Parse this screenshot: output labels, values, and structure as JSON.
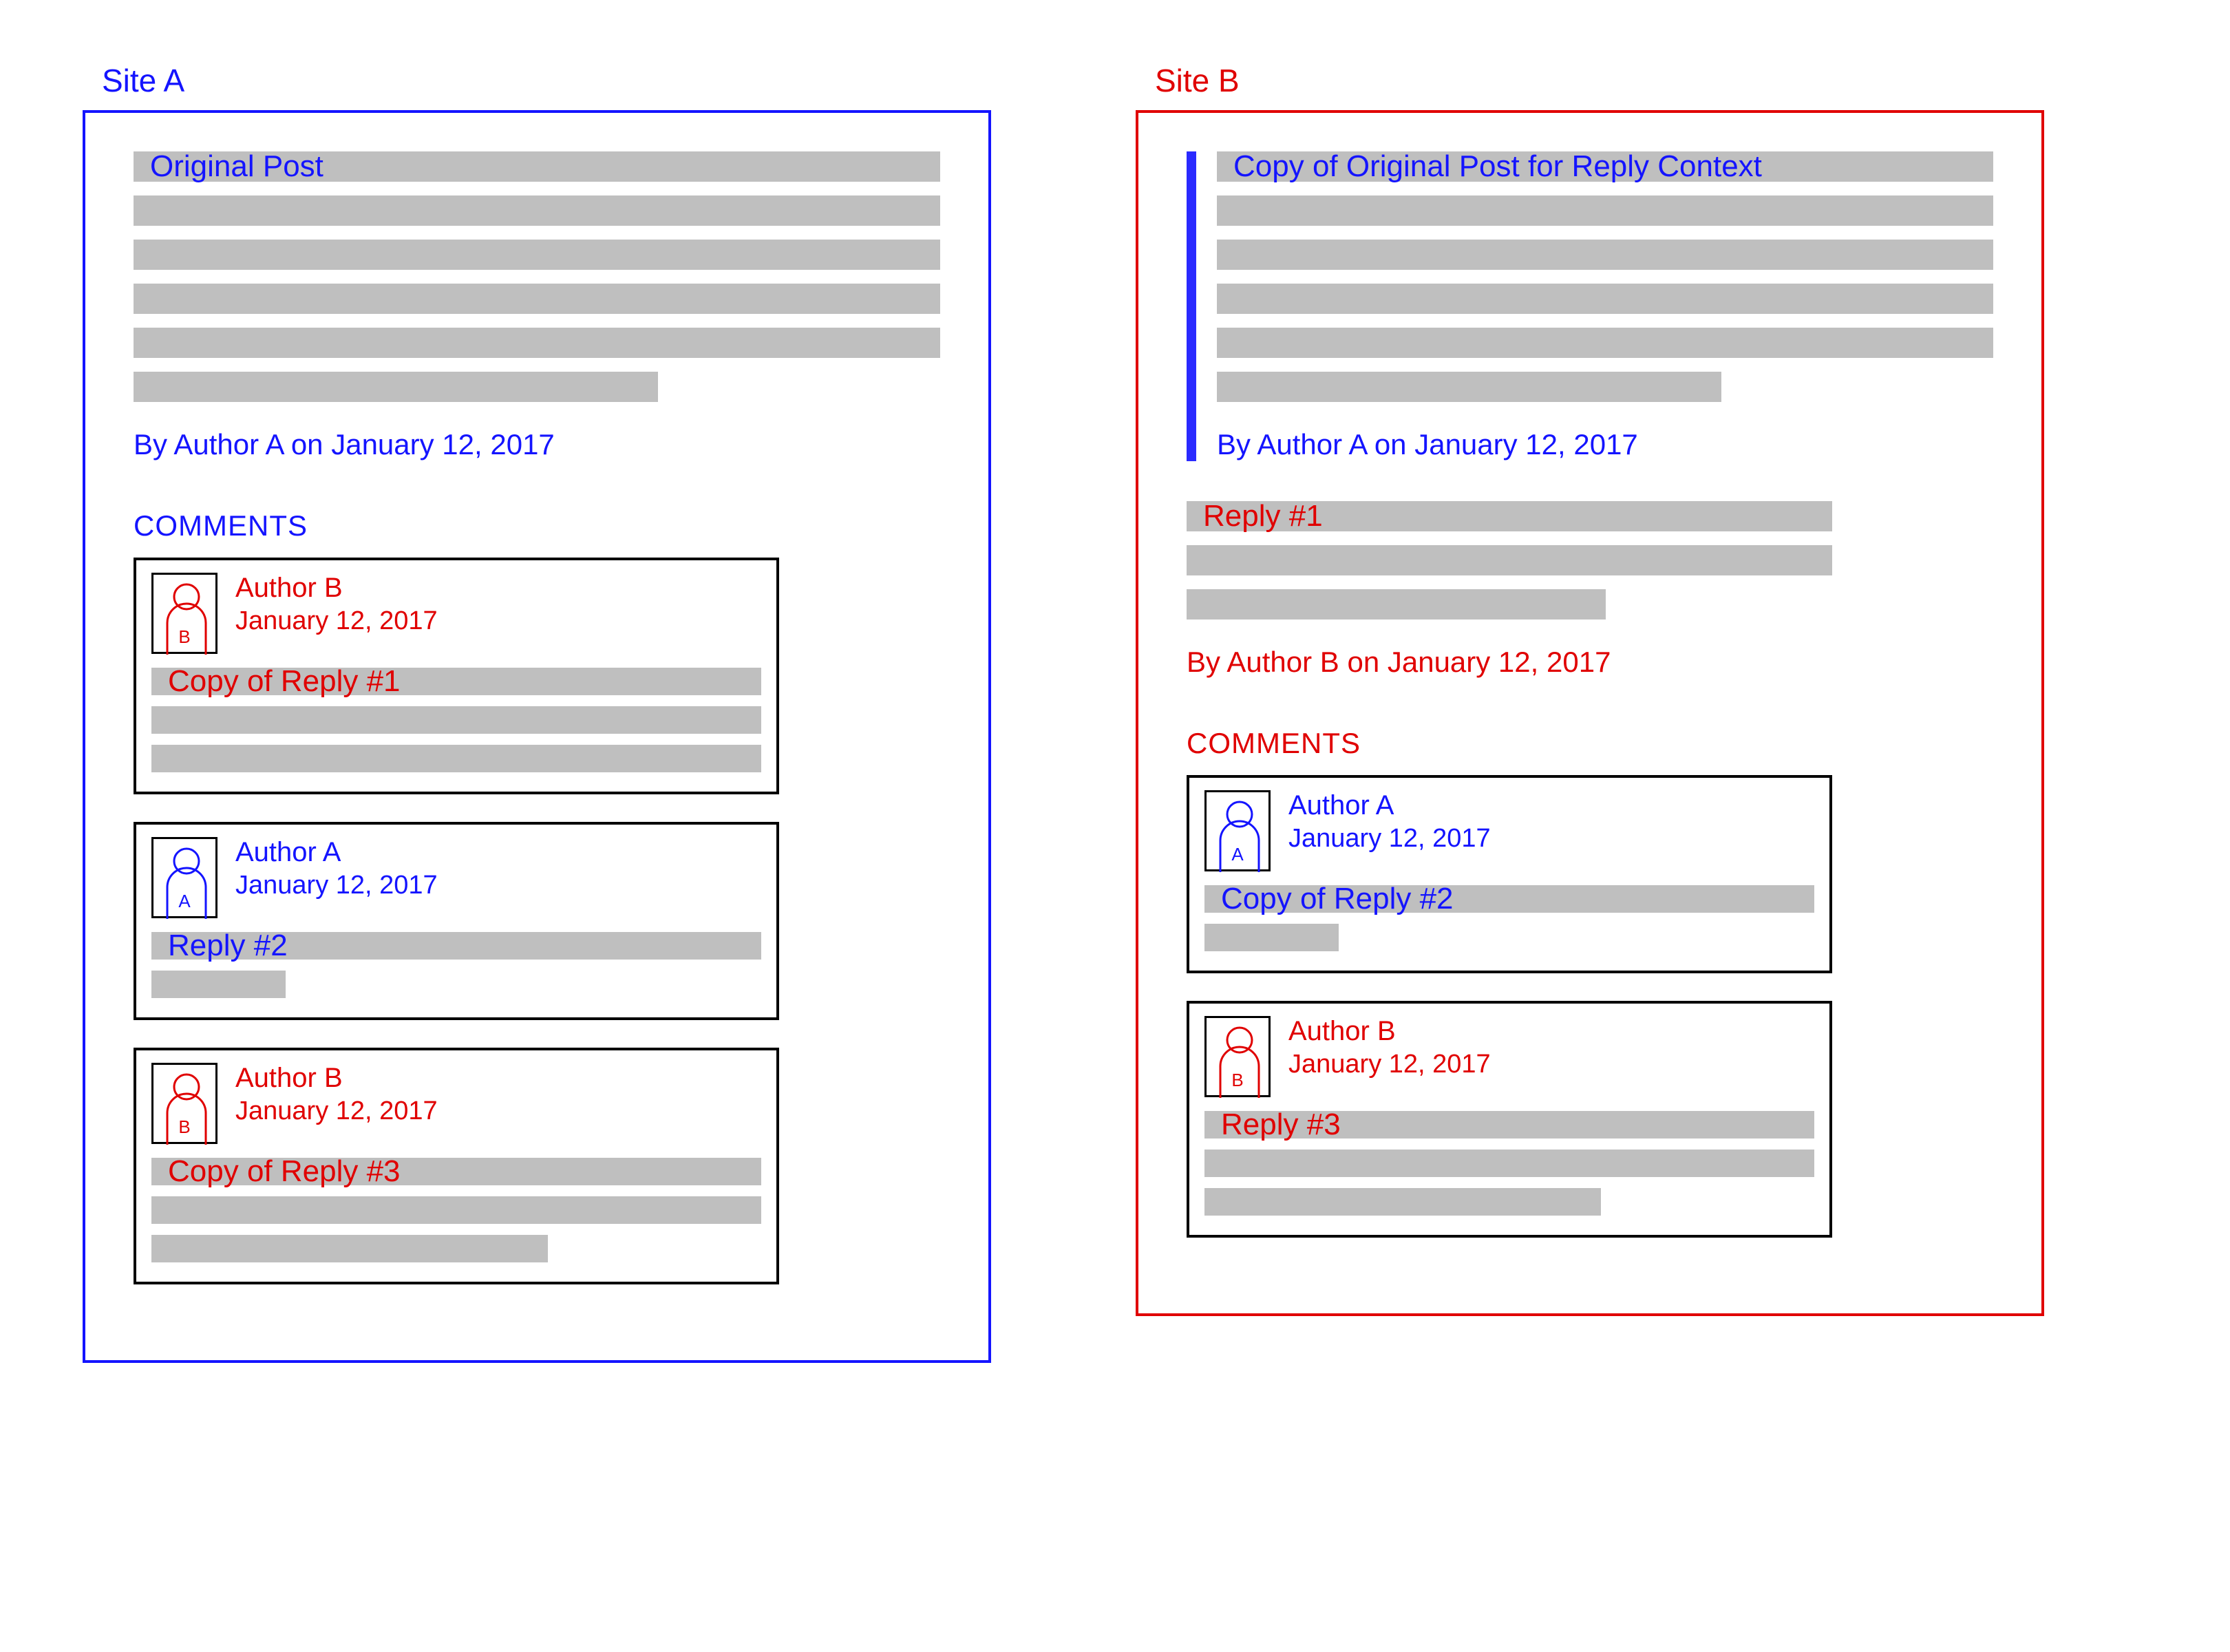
{
  "siteA": {
    "label": "Site A",
    "post": {
      "title": "Original Post",
      "byline": "By Author A on January 12, 2017"
    },
    "commentsHeading": "COMMENTS",
    "comments": [
      {
        "avatarLetter": "B",
        "author": "Author B",
        "date": "January 12, 2017",
        "bodyLabel": "Copy of Reply #1",
        "color": "red"
      },
      {
        "avatarLetter": "A",
        "author": "Author A",
        "date": "January 12, 2017",
        "bodyLabel": "Reply #2",
        "color": "blue"
      },
      {
        "avatarLetter": "B",
        "author": "Author B",
        "date": "January 12, 2017",
        "bodyLabel": "Copy of Reply #3",
        "color": "red"
      }
    ]
  },
  "siteB": {
    "label": "Site B",
    "quotedPost": {
      "title": "Copy of Original Post for Reply Context",
      "byline": "By Author A on January 12, 2017"
    },
    "reply": {
      "title": "Reply #1",
      "byline": "By Author B on January 12, 2017"
    },
    "commentsHeading": "COMMENTS",
    "comments": [
      {
        "avatarLetter": "A",
        "author": "Author A",
        "date": "January 12, 2017",
        "bodyLabel": "Copy of Reply #2",
        "color": "blue"
      },
      {
        "avatarLetter": "B",
        "author": "Author B",
        "date": "January 12, 2017",
        "bodyLabel": "Reply #3",
        "color": "red"
      }
    ]
  }
}
